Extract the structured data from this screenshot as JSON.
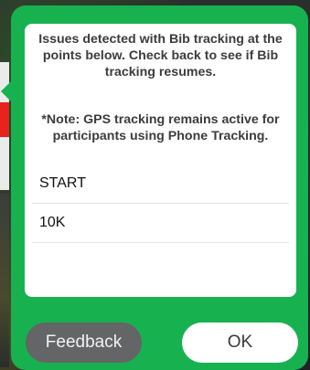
{
  "dialog": {
    "message": "Issues detected with Bib tracking at the points below. Check back to see if Bib tracking resumes.",
    "note": "*Note: GPS tracking remains active for participants using Phone Tracking.",
    "points": [
      "START",
      "10K"
    ],
    "feedback_label": "Feedback",
    "ok_label": "OK"
  },
  "colors": {
    "popover_green": "#18b14f",
    "feedback_button": "#636566",
    "ok_button": "#ffffff"
  }
}
